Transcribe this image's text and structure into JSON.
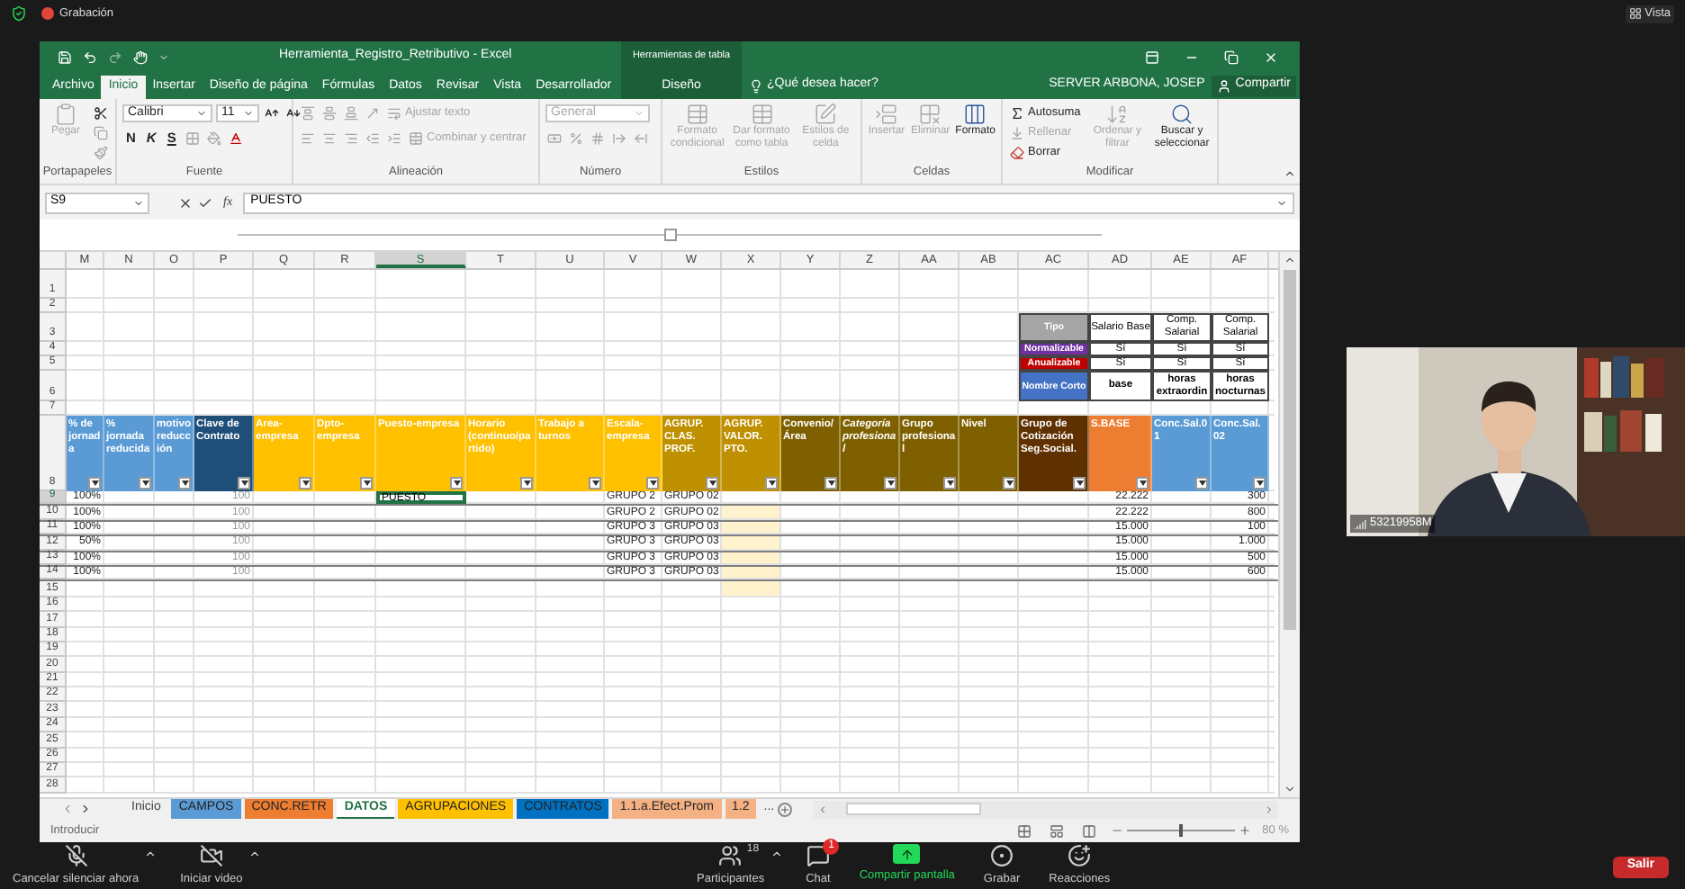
{
  "meeting": {
    "recording": "Grabación",
    "view": "Vista"
  },
  "excel": {
    "title": "Herramienta_Registro_Retributivo - Excel",
    "contextual_group": "Herramientas de tabla",
    "tabs": [
      {
        "label": "Archivo",
        "selected": false
      },
      {
        "label": "Inicio",
        "selected": true
      },
      {
        "label": "Insertar",
        "selected": false
      },
      {
        "label": "Diseño de página",
        "selected": false
      },
      {
        "label": "Fórmulas",
        "selected": false
      },
      {
        "label": "Datos",
        "selected": false
      },
      {
        "label": "Revisar",
        "selected": false
      },
      {
        "label": "Vista",
        "selected": false
      },
      {
        "label": "Desarrollador",
        "selected": false
      }
    ],
    "contextual_tab": {
      "label": "Diseño",
      "selected": false
    },
    "tell_me": "¿Qué desea hacer?",
    "user": "SERVER ARBONA, JOSEP",
    "share": "Compartir",
    "ribbon": {
      "groups": [
        {
          "kind": "clipboard",
          "label": "Portapapeles",
          "large": [
            {
              "kind": "paste",
              "label": "Pegar",
              "disabled": true
            }
          ],
          "rows": [
            {
              "items": [
                {
                  "kind": "cut",
                  "disabled": false
                }
              ]
            },
            {
              "items": [
                {
                  "kind": "copy",
                  "disabled": true
                }
              ]
            },
            {
              "items": [
                {
                  "kind": "brush",
                  "disabled": true
                }
              ]
            }
          ]
        },
        {
          "kind": "font",
          "label": "Fuente",
          "rows": [
            {
              "items": [
                {
                  "kind": "font-field",
                  "label": "Calibri",
                  "disabled": false
                },
                {
                  "kind": "size-field",
                  "label": "11",
                  "disabled": false
                },
                {
                  "kind": "grow",
                  "disabled": false
                },
                {
                  "kind": "shrink",
                  "disabled": false
                }
              ]
            },
            {
              "items": [
                {
                  "kind": "bold",
                  "label": "N",
                  "disabled": false
                },
                {
                  "kind": "italic",
                  "label": "K",
                  "disabled": false
                },
                {
                  "kind": "underline",
                  "label": "S",
                  "disabled": false
                },
                {
                  "kind": "borders",
                  "disabled": true
                },
                {
                  "kind": "fill-color",
                  "disabled": true
                },
                {
                  "kind": "font-color",
                  "disabled": false
                }
              ]
            }
          ]
        },
        {
          "kind": "alignment",
          "label": "Alineación",
          "rows": [
            {
              "items": [
                {
                  "kind": "align-top",
                  "disabled": true
                },
                {
                  "kind": "align-middle",
                  "disabled": true
                },
                {
                  "kind": "align-bottom",
                  "disabled": true
                },
                {
                  "kind": "orientation",
                  "disabled": true
                },
                {
                  "kind": "wrap",
                  "label": "Ajustar texto",
                  "disabled": true
                }
              ]
            },
            {
              "items": [
                {
                  "kind": "align-left",
                  "disabled": true
                },
                {
                  "kind": "align-center",
                  "disabled": true
                },
                {
                  "kind": "align-right",
                  "disabled": true
                },
                {
                  "kind": "outdent",
                  "disabled": true
                },
                {
                  "kind": "indent",
                  "disabled": true
                },
                {
                  "kind": "merge",
                  "label": "Combinar y centrar",
                  "disabled": true
                }
              ]
            }
          ]
        },
        {
          "kind": "number",
          "label": "Número",
          "rows": [
            {
              "items": [
                {
                  "kind": "format-field",
                  "label": "General",
                  "disabled": true
                }
              ]
            },
            {
              "items": [
                {
                  "kind": "currency",
                  "disabled": true
                },
                {
                  "kind": "percent",
                  "disabled": true
                },
                {
                  "kind": "thousands",
                  "disabled": true
                },
                {
                  "kind": "increase-decimal",
                  "disabled": true
                },
                {
                  "kind": "decrease-decimal",
                  "disabled": true
                }
              ]
            }
          ]
        },
        {
          "kind": "styles",
          "label": "Estilos",
          "large": [
            {
              "kind": "cond-format",
              "label": "Formato condicional",
              "disabled": true
            },
            {
              "kind": "table-format",
              "label": "Dar formato como tabla",
              "disabled": true
            },
            {
              "kind": "cell-styles",
              "label": "Estilos de celda",
              "disabled": true
            }
          ]
        },
        {
          "kind": "cells",
          "label": "Celdas",
          "large": [
            {
              "kind": "insert",
              "label": "Insertar",
              "disabled": true
            },
            {
              "kind": "delete",
              "label": "Eliminar",
              "disabled": true
            },
            {
              "kind": "format",
              "label": "Formato",
              "disabled": false
            }
          ]
        },
        {
          "kind": "editing",
          "label": "Modificar",
          "rows": [
            {
              "items": [
                {
                  "kind": "autosum",
                  "label": "Autosuma",
                  "disabled": false
                }
              ]
            },
            {
              "items": [
                {
                  "kind": "fill",
                  "label": "Rellenar",
                  "disabled": true
                }
              ]
            },
            {
              "items": [
                {
                  "kind": "clear",
                  "label": "Borrar",
                  "disabled": false
                }
              ]
            }
          ],
          "large": [
            {
              "kind": "sort",
              "label": "Ordenar y filtrar",
              "disabled": true
            },
            {
              "kind": "find",
              "label": "Buscar y seleccionar",
              "disabled": false
            }
          ]
        }
      ]
    },
    "name_box": "S9",
    "formula_label": "fx",
    "formula": "PUESTO",
    "sheet": {
      "columns": [
        {
          "letter": "M",
          "header": "% de jornada",
          "color": "#5b9bd5",
          "italic": false
        },
        {
          "letter": "N",
          "header": "% jornada reducida",
          "color": "#5b9bd5",
          "italic": false
        },
        {
          "letter": "O",
          "header": "motivo reducción",
          "color": "#5b9bd5",
          "italic": false
        },
        {
          "letter": "P",
          "header": "Clave de Contrato",
          "color": "#1f4e79",
          "italic": false
        },
        {
          "letter": "Q",
          "header": "Area-empresa",
          "color": "#ffc000",
          "italic": false
        },
        {
          "letter": "R",
          "header": "Dpto-empresa",
          "color": "#ffc000",
          "italic": false
        },
        {
          "letter": "S",
          "header": "Puesto-empresa",
          "color": "#ffc000",
          "italic": false
        },
        {
          "letter": "T",
          "header": "Horario (continuo/partido)",
          "color": "#ffc000",
          "italic": false
        },
        {
          "letter": "U",
          "header": "Trabajo a turnos",
          "color": "#ffc000",
          "italic": false
        },
        {
          "letter": "V",
          "header": "Escala-empresa",
          "color": "#ffc000",
          "italic": false
        },
        {
          "letter": "W",
          "header": "AGRUP. CLAS. PROF.",
          "color": "#bf9000",
          "italic": false
        },
        {
          "letter": "X",
          "header": "AGRUP. VALOR. PTO.",
          "color": "#bf9000",
          "italic": false
        },
        {
          "letter": "Y",
          "header": "Convenio/ Área",
          "color": "#7f6000",
          "italic": false
        },
        {
          "letter": "Z",
          "header": "Categoría profesional",
          "color": "#7f6000",
          "italic": true
        },
        {
          "letter": "AA",
          "header": "Grupo profesional",
          "color": "#7f6000",
          "italic": false
        },
        {
          "letter": "AB",
          "header": "Nivel",
          "color": "#7f6000",
          "italic": false
        },
        {
          "letter": "AC",
          "header": "Grupo de Cotización Seg.Social.",
          "color": "#5f3100",
          "italic": false
        },
        {
          "letter": "AD",
          "header": "S.BASE",
          "color": "#ed7d31",
          "italic": false
        },
        {
          "letter": "AE",
          "header": "Conc.Sal.01",
          "color": "#5b9bd5",
          "italic": false
        },
        {
          "letter": "AF",
          "header": "Conc.Sal.02",
          "color": "#5b9bd5",
          "italic": false
        }
      ],
      "rows": [
        {
          "number": "1",
          "kind": "blank"
        },
        {
          "number": "2",
          "kind": "blank"
        },
        {
          "number": "3",
          "kind": "lookup",
          "lookup": {
            "label": "Tipo",
            "color": "#a5a5a5",
            "bold_values": false,
            "values": [
              "Salario Base",
              "Comp. Salarial",
              "Comp. Salarial"
            ]
          }
        },
        {
          "number": "4",
          "kind": "lookup",
          "lookup": {
            "label": "Normalizable",
            "color": "#7030a0",
            "bold_values": false,
            "values": [
              "Sí",
              "Sí",
              "Sí"
            ]
          }
        },
        {
          "number": "5",
          "kind": "lookup",
          "lookup": {
            "label": "Anualizable",
            "color": "#c00000",
            "bold_values": false,
            "values": [
              "Sí",
              "Sí",
              "Sí"
            ]
          }
        },
        {
          "number": "6",
          "kind": "lookup",
          "lookup": {
            "label": "Nombre Corto",
            "color": "#4472c4",
            "bold_values": true,
            "values": [
              "base",
              "horas extraordin",
              "horas nocturnas"
            ]
          }
        },
        {
          "number": "7",
          "kind": "blank"
        },
        {
          "number": "8",
          "kind": "header"
        },
        {
          "number": "9",
          "kind": "data",
          "x_shaded": false,
          "cells": {
            "M": "100%",
            "P": "100",
            "S": {
              "text": "PUESTO",
              "selected": true
            },
            "V": "GRUPO 2",
            "W": "GRUPO 02",
            "AD": "22.222",
            "AF": "300"
          }
        },
        {
          "number": "10",
          "kind": "data",
          "x_shaded": true,
          "cells": {
            "M": "100%",
            "P": "100",
            "V": "GRUPO 2",
            "W": "GRUPO 02",
            "AD": "22.222",
            "AF": "800"
          }
        },
        {
          "number": "11",
          "kind": "data",
          "x_shaded": true,
          "cells": {
            "M": "100%",
            "P": "100",
            "V": "GRUPO 3",
            "W": "GRUPO 03",
            "AD": "15.000",
            "AF": "100"
          }
        },
        {
          "number": "12",
          "kind": "data",
          "x_shaded": true,
          "cells": {
            "M": "50%",
            "P": "100",
            "V": "GRUPO 3",
            "W": "GRUPO 03",
            "AD": "15.000",
            "AF": "1.000"
          }
        },
        {
          "number": "13",
          "kind": "data",
          "x_shaded": true,
          "cells": {
            "M": "100%",
            "P": "100",
            "V": "GRUPO 3",
            "W": "GRUPO 03",
            "AD": "15.000",
            "AF": "500"
          }
        },
        {
          "number": "14",
          "kind": "data",
          "x_shaded": true,
          "cells": {
            "M": "100%",
            "P": "100",
            "V": "GRUPO 3",
            "W": "GRUPO 03",
            "AD": "15.000",
            "AF": "600"
          }
        },
        {
          "number": "15",
          "kind": "blank",
          "x_shaded": true
        },
        {
          "number": "16",
          "kind": "blank"
        },
        {
          "number": "17",
          "kind": "blank"
        },
        {
          "number": "18",
          "kind": "blank"
        },
        {
          "number": "19",
          "kind": "blank"
        },
        {
          "number": "20",
          "kind": "blank"
        },
        {
          "number": "21",
          "kind": "blank"
        },
        {
          "number": "22",
          "kind": "blank"
        },
        {
          "number": "23",
          "kind": "blank"
        },
        {
          "number": "24",
          "kind": "blank"
        },
        {
          "number": "25",
          "kind": "blank"
        },
        {
          "number": "26",
          "kind": "blank"
        },
        {
          "number": "27",
          "kind": "blank"
        },
        {
          "number": "28",
          "kind": "blank"
        }
      ]
    },
    "sheet_tabs": [
      {
        "label": "Inicio",
        "selected": false
      },
      {
        "label": "CAMPOS",
        "color": "#5b9bd5",
        "selected": false
      },
      {
        "label": "CONC.RETR",
        "color": "#ed7d31",
        "selected": false
      },
      {
        "label": "DATOS",
        "selected": true
      },
      {
        "label": "AGRUPACIONES",
        "color": "#ffc000",
        "selected": false
      },
      {
        "label": "CONTRATOS",
        "color": "#0070c0",
        "selected": false
      },
      {
        "label": "1.1.a.Efect.Prom",
        "color": "#f4b183",
        "selected": false
      },
      {
        "label": "1.2",
        "color": "#f4b183",
        "selected": false
      }
    ],
    "more_tabs": "...",
    "status": "Introducir",
    "zoom": {
      "label": "80 %",
      "level": 0.48
    }
  },
  "video": {
    "name": "53219958M"
  },
  "toolbar": {
    "items": [
      {
        "kind": "mic",
        "label": "Cancelar silenciar ahora",
        "caret": true
      },
      {
        "kind": "video",
        "label": "Iniciar video",
        "caret": true
      },
      {
        "kind": "participants",
        "label": "Participantes",
        "count": "18",
        "caret": true
      },
      {
        "kind": "chat",
        "label": "Chat",
        "badge": "1",
        "caret": false
      },
      {
        "kind": "share",
        "label": "Compartir pantalla",
        "caret": false
      },
      {
        "kind": "record",
        "label": "Grabar",
        "caret": false
      },
      {
        "kind": "reactions",
        "label": "Reacciones",
        "caret": false
      }
    ],
    "leave": "Salir"
  }
}
